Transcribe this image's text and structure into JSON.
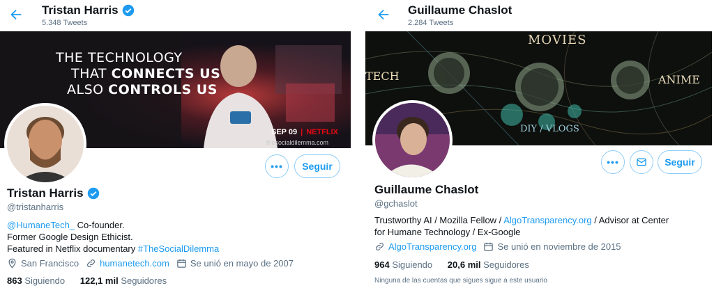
{
  "left": {
    "header_name": "Tristan Harris",
    "tweets": "5.348 Tweets",
    "banner": {
      "line1": "THE TECHNOLOGY",
      "line2a": "THAT ",
      "line2b": "CONNECTS US",
      "line3a": "ALSO ",
      "line3b": "CONTROLS US",
      "date": "SEP 09",
      "brand": "NETFLIX",
      "site": "thesocialdilemma.com"
    },
    "more_label": "•••",
    "follow_label": "Seguir",
    "name": "Tristan Harris",
    "handle": "@tristanharris",
    "bio_mention": "@HumaneTech_",
    "bio_1": " Co-founder.",
    "bio_2": "Former Google Design Ethicist.",
    "bio_3": "Featured in Netflix documentary ",
    "bio_hashtag": "#TheSocialDilemma",
    "location": "San Francisco",
    "website": "humanetech.com",
    "joined": "Se unió en mayo de 2007",
    "following_count": "863",
    "following_label": " Siguiendo",
    "followers_count": "122,1 mil",
    "followers_label": " Seguidores"
  },
  "right": {
    "header_name": "Guillaume Chaslot",
    "tweets": "2.284 Tweets",
    "banner": {
      "movies": "MOVIES",
      "tech": "TECH",
      "anime": "ANIME",
      "diy": "DIY / VLOGS"
    },
    "more_label": "•••",
    "follow_label": "Seguir",
    "name": "Guillaume Chaslot",
    "handle": "@gchaslot",
    "bio_1": "Trustworthy AI / Mozilla Fellow / ",
    "bio_link": "AlgoTransparency.org",
    "bio_2": " / Advisor at Center for Humane Technology / Ex-Google",
    "website": "AlgoTransparency.org",
    "joined": "Se unió en noviembre de 2015",
    "following_count": "964",
    "following_label": " Siguiendo",
    "followers_count": "20,6 mil",
    "followers_label": " Seguidores",
    "note": "Ninguna de las cuentas que sigues sigue a este usuario"
  },
  "colors": {
    "accent": "#1d9bf0",
    "muted": "#5b7083",
    "netflix": "#e50914"
  }
}
